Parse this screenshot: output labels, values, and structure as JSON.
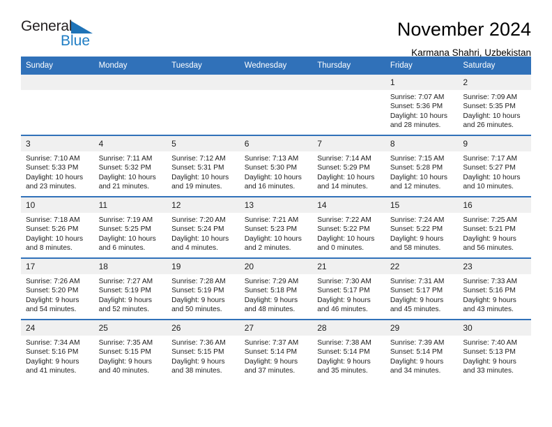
{
  "brand": {
    "name_part1": "General",
    "name_part2": "Blue",
    "accent_color": "#1f7dc4",
    "triangle_color": "#1f73b7"
  },
  "header": {
    "title": "November 2024",
    "subtitle": "Karmana Shahri, Uzbekistan"
  },
  "calendar": {
    "header_color": "#3071b9",
    "weekday_headers": [
      "Sunday",
      "Monday",
      "Tuesday",
      "Wednesday",
      "Thursday",
      "Friday",
      "Saturday"
    ],
    "weeks": [
      [
        {
          "date": "",
          "sunrise": "",
          "sunset": "",
          "daylight": ""
        },
        {
          "date": "",
          "sunrise": "",
          "sunset": "",
          "daylight": ""
        },
        {
          "date": "",
          "sunrise": "",
          "sunset": "",
          "daylight": ""
        },
        {
          "date": "",
          "sunrise": "",
          "sunset": "",
          "daylight": ""
        },
        {
          "date": "",
          "sunrise": "",
          "sunset": "",
          "daylight": ""
        },
        {
          "date": "1",
          "sunrise": "Sunrise: 7:07 AM",
          "sunset": "Sunset: 5:36 PM",
          "daylight": "Daylight: 10 hours and 28 minutes."
        },
        {
          "date": "2",
          "sunrise": "Sunrise: 7:09 AM",
          "sunset": "Sunset: 5:35 PM",
          "daylight": "Daylight: 10 hours and 26 minutes."
        }
      ],
      [
        {
          "date": "3",
          "sunrise": "Sunrise: 7:10 AM",
          "sunset": "Sunset: 5:33 PM",
          "daylight": "Daylight: 10 hours and 23 minutes."
        },
        {
          "date": "4",
          "sunrise": "Sunrise: 7:11 AM",
          "sunset": "Sunset: 5:32 PM",
          "daylight": "Daylight: 10 hours and 21 minutes."
        },
        {
          "date": "5",
          "sunrise": "Sunrise: 7:12 AM",
          "sunset": "Sunset: 5:31 PM",
          "daylight": "Daylight: 10 hours and 19 minutes."
        },
        {
          "date": "6",
          "sunrise": "Sunrise: 7:13 AM",
          "sunset": "Sunset: 5:30 PM",
          "daylight": "Daylight: 10 hours and 16 minutes."
        },
        {
          "date": "7",
          "sunrise": "Sunrise: 7:14 AM",
          "sunset": "Sunset: 5:29 PM",
          "daylight": "Daylight: 10 hours and 14 minutes."
        },
        {
          "date": "8",
          "sunrise": "Sunrise: 7:15 AM",
          "sunset": "Sunset: 5:28 PM",
          "daylight": "Daylight: 10 hours and 12 minutes."
        },
        {
          "date": "9",
          "sunrise": "Sunrise: 7:17 AM",
          "sunset": "Sunset: 5:27 PM",
          "daylight": "Daylight: 10 hours and 10 minutes."
        }
      ],
      [
        {
          "date": "10",
          "sunrise": "Sunrise: 7:18 AM",
          "sunset": "Sunset: 5:26 PM",
          "daylight": "Daylight: 10 hours and 8 minutes."
        },
        {
          "date": "11",
          "sunrise": "Sunrise: 7:19 AM",
          "sunset": "Sunset: 5:25 PM",
          "daylight": "Daylight: 10 hours and 6 minutes."
        },
        {
          "date": "12",
          "sunrise": "Sunrise: 7:20 AM",
          "sunset": "Sunset: 5:24 PM",
          "daylight": "Daylight: 10 hours and 4 minutes."
        },
        {
          "date": "13",
          "sunrise": "Sunrise: 7:21 AM",
          "sunset": "Sunset: 5:23 PM",
          "daylight": "Daylight: 10 hours and 2 minutes."
        },
        {
          "date": "14",
          "sunrise": "Sunrise: 7:22 AM",
          "sunset": "Sunset: 5:22 PM",
          "daylight": "Daylight: 10 hours and 0 minutes."
        },
        {
          "date": "15",
          "sunrise": "Sunrise: 7:24 AM",
          "sunset": "Sunset: 5:22 PM",
          "daylight": "Daylight: 9 hours and 58 minutes."
        },
        {
          "date": "16",
          "sunrise": "Sunrise: 7:25 AM",
          "sunset": "Sunset: 5:21 PM",
          "daylight": "Daylight: 9 hours and 56 minutes."
        }
      ],
      [
        {
          "date": "17",
          "sunrise": "Sunrise: 7:26 AM",
          "sunset": "Sunset: 5:20 PM",
          "daylight": "Daylight: 9 hours and 54 minutes."
        },
        {
          "date": "18",
          "sunrise": "Sunrise: 7:27 AM",
          "sunset": "Sunset: 5:19 PM",
          "daylight": "Daylight: 9 hours and 52 minutes."
        },
        {
          "date": "19",
          "sunrise": "Sunrise: 7:28 AM",
          "sunset": "Sunset: 5:19 PM",
          "daylight": "Daylight: 9 hours and 50 minutes."
        },
        {
          "date": "20",
          "sunrise": "Sunrise: 7:29 AM",
          "sunset": "Sunset: 5:18 PM",
          "daylight": "Daylight: 9 hours and 48 minutes."
        },
        {
          "date": "21",
          "sunrise": "Sunrise: 7:30 AM",
          "sunset": "Sunset: 5:17 PM",
          "daylight": "Daylight: 9 hours and 46 minutes."
        },
        {
          "date": "22",
          "sunrise": "Sunrise: 7:31 AM",
          "sunset": "Sunset: 5:17 PM",
          "daylight": "Daylight: 9 hours and 45 minutes."
        },
        {
          "date": "23",
          "sunrise": "Sunrise: 7:33 AM",
          "sunset": "Sunset: 5:16 PM",
          "daylight": "Daylight: 9 hours and 43 minutes."
        }
      ],
      [
        {
          "date": "24",
          "sunrise": "Sunrise: 7:34 AM",
          "sunset": "Sunset: 5:16 PM",
          "daylight": "Daylight: 9 hours and 41 minutes."
        },
        {
          "date": "25",
          "sunrise": "Sunrise: 7:35 AM",
          "sunset": "Sunset: 5:15 PM",
          "daylight": "Daylight: 9 hours and 40 minutes."
        },
        {
          "date": "26",
          "sunrise": "Sunrise: 7:36 AM",
          "sunset": "Sunset: 5:15 PM",
          "daylight": "Daylight: 9 hours and 38 minutes."
        },
        {
          "date": "27",
          "sunrise": "Sunrise: 7:37 AM",
          "sunset": "Sunset: 5:14 PM",
          "daylight": "Daylight: 9 hours and 37 minutes."
        },
        {
          "date": "28",
          "sunrise": "Sunrise: 7:38 AM",
          "sunset": "Sunset: 5:14 PM",
          "daylight": "Daylight: 9 hours and 35 minutes."
        },
        {
          "date": "29",
          "sunrise": "Sunrise: 7:39 AM",
          "sunset": "Sunset: 5:14 PM",
          "daylight": "Daylight: 9 hours and 34 minutes."
        },
        {
          "date": "30",
          "sunrise": "Sunrise: 7:40 AM",
          "sunset": "Sunset: 5:13 PM",
          "daylight": "Daylight: 9 hours and 33 minutes."
        }
      ]
    ]
  }
}
